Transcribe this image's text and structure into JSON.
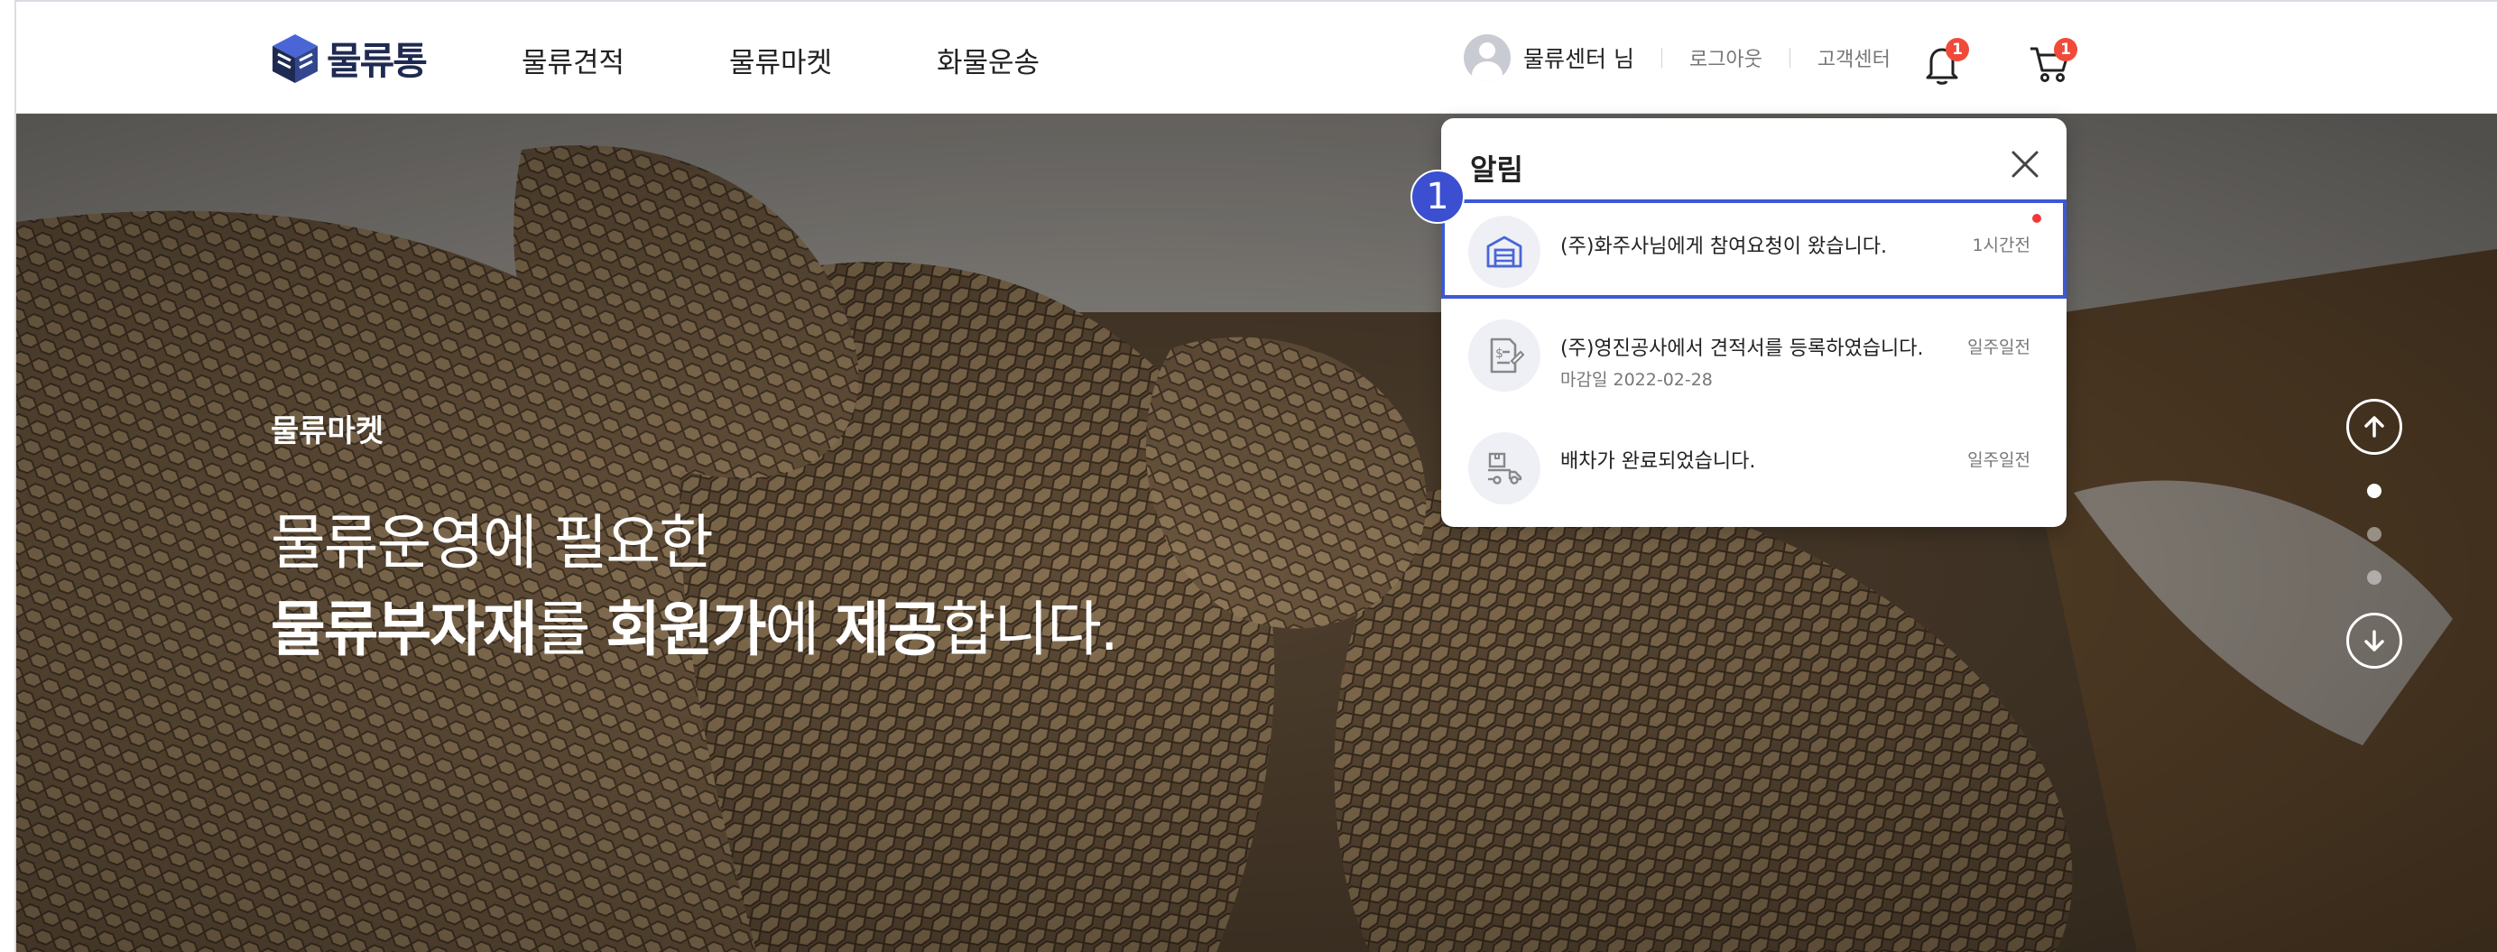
{
  "header": {
    "logo_text": "물류통",
    "nav": [
      "물류견적",
      "물류마켓",
      "화물운송"
    ],
    "user_name": "물류센터 님",
    "logout": "로그아웃",
    "support": "고객센터",
    "notification_count": "1",
    "cart_count": "1"
  },
  "hero": {
    "subtitle": "물류마켓",
    "line1": "물류운영에 필요한",
    "line2_parts": [
      "물류부자재",
      "를 ",
      "회원가",
      "에 ",
      "제공",
      "합니다."
    ],
    "slide_count": 3,
    "active_slide": 1
  },
  "notifications": {
    "title": "알림",
    "items": [
      {
        "text": "(주)화주사님에게 참여요청이 왔습니다.",
        "sub": "",
        "time": "1시간전",
        "icon": "warehouse-icon",
        "unread": true
      },
      {
        "text": "(주)영진공사에서 견적서를 등록하였습니다.",
        "sub": "마감일 2022-02-28",
        "time": "일주일전",
        "icon": "quote-document-icon",
        "unread": false
      },
      {
        "text": "배차가 완료되었습니다.",
        "sub": "",
        "time": "일주일전",
        "icon": "delivery-truck-icon",
        "unread": false
      }
    ]
  },
  "annotation": {
    "step": "1"
  },
  "colors": {
    "accent": "#3b58d6",
    "badge": "#f04a3a",
    "marker": "#3b4fd0",
    "logo": "#1f2a52"
  }
}
